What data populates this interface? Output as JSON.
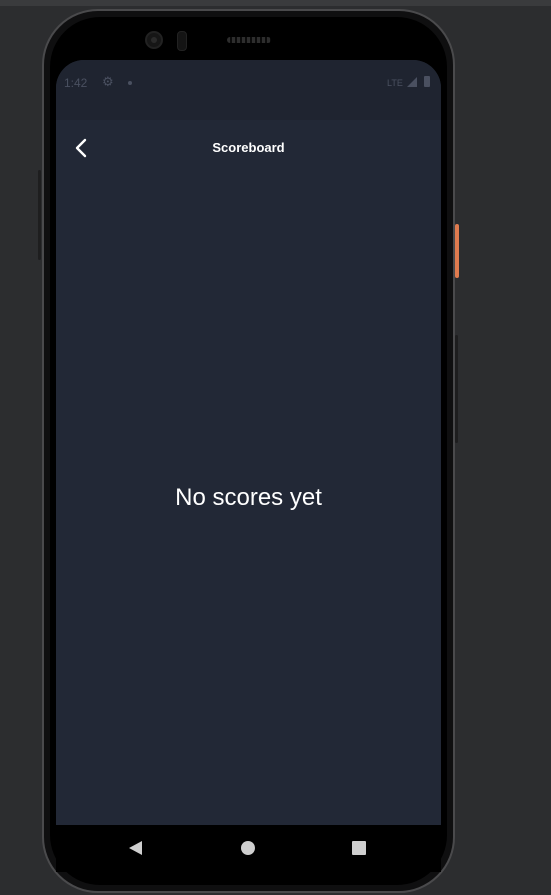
{
  "status_bar": {
    "time": "1:42",
    "settings_icon": "gear-icon",
    "network": "LTE",
    "signal_icon": "signal-icon",
    "battery_icon": "battery-icon"
  },
  "app_bar": {
    "back_icon": "chevron-left-icon",
    "title": "Scoreboard"
  },
  "main": {
    "empty_message": "No scores yet"
  },
  "nav_bar": {
    "back_icon": "nav-back-icon",
    "home_icon": "nav-home-icon",
    "recents_icon": "nav-recents-icon"
  },
  "colors": {
    "background": "#222836",
    "text": "#ffffff",
    "accent_power_button": "#e07b4f"
  }
}
